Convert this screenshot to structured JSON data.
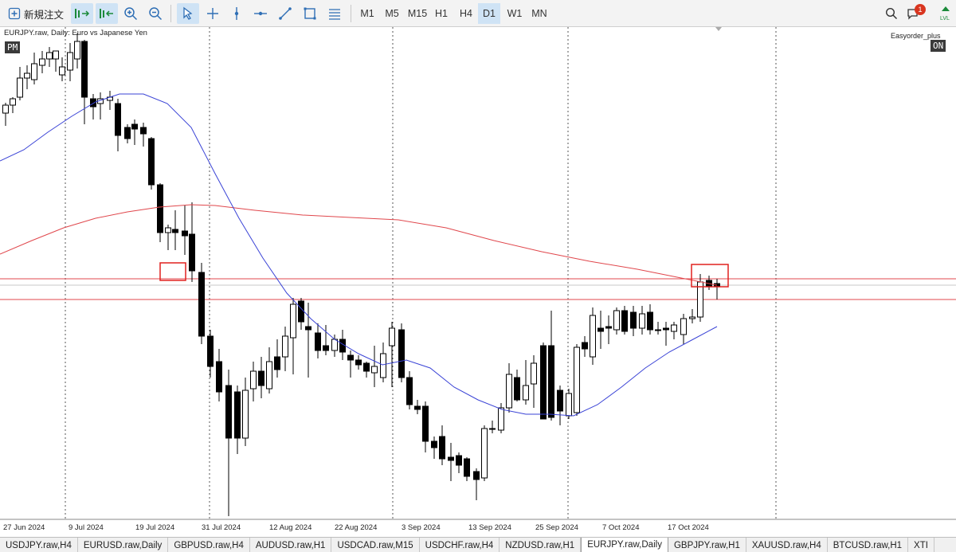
{
  "toolbar": {
    "new_order_label": "新規注文",
    "timeframes": [
      "M1",
      "M5",
      "M15",
      "H1",
      "H4",
      "D1",
      "W1",
      "MN"
    ],
    "active_timeframe": "D1",
    "notification_count": "1"
  },
  "chart": {
    "title": "EURJPY.raw, Daily:  Euro vs Japanese Yen",
    "badge_left": "PM",
    "badge_right": "ON",
    "indicator_label": "Easyorder_plus",
    "date_labels": [
      "27 Jun 2024",
      "9 Jul 2024",
      "19 Jul 2024",
      "31 Jul 2024",
      "12 Aug 2024",
      "22 Aug 2024",
      "3 Sep 2024",
      "13 Sep 2024",
      "25 Sep 2024",
      "7 Oct 2024",
      "17 Oct 2024"
    ],
    "colors": {
      "fast_ma": "#3a43d6",
      "slow_ma": "#e0474c",
      "hline": "#e0474c",
      "box": "#e0211f",
      "bull": "#ffffff",
      "bear": "#000000"
    }
  },
  "tabs": [
    "USDJPY.raw,H4",
    "EURUSD.raw,Daily",
    "GBPUSD.raw,H4",
    "AUDUSD.raw,H1",
    "USDCAD.raw,M15",
    "USDCHF.raw,H4",
    "NZDUSD.raw,H1",
    "EURJPY.raw,Daily",
    "GBPJPY.raw,H1",
    "XAUUSD.raw,H4",
    "BTCUSD.raw,H1",
    "XTI"
  ],
  "active_tab": "EURJPY.raw,Daily"
}
